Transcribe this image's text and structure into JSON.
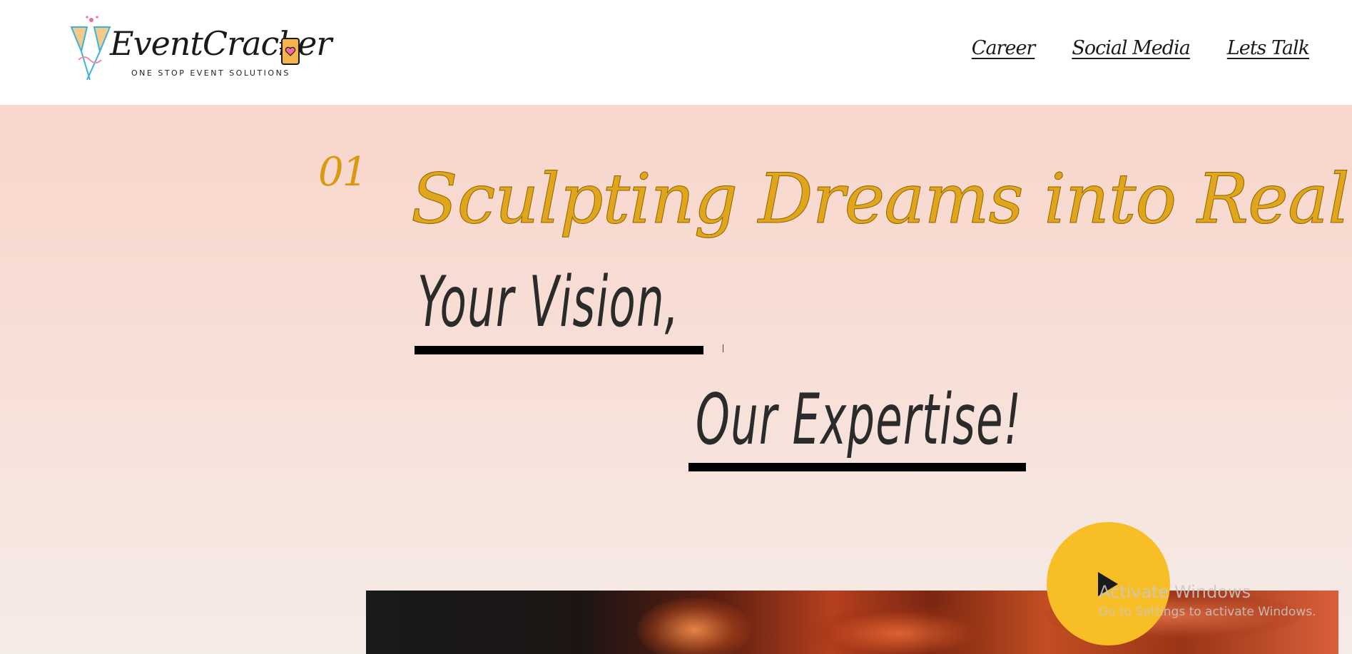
{
  "brand": {
    "name": "EventCracker",
    "tagline": "ONE STOP EVENT SOLUTIONS"
  },
  "nav": {
    "items": [
      {
        "label": "Career"
      },
      {
        "label": "Social Media"
      },
      {
        "label": "Lets Talk"
      }
    ]
  },
  "hero": {
    "number": "01",
    "headline": "Sculpting Dreams into Reality",
    "line1": "Your Vision,",
    "line2": "Our Expertise!",
    "accent_color": "#e0a51a",
    "play_button_color": "#f7be26"
  },
  "watermark": {
    "title": "Activate Windows",
    "subtitle": "Go to Settings to activate Windows."
  }
}
